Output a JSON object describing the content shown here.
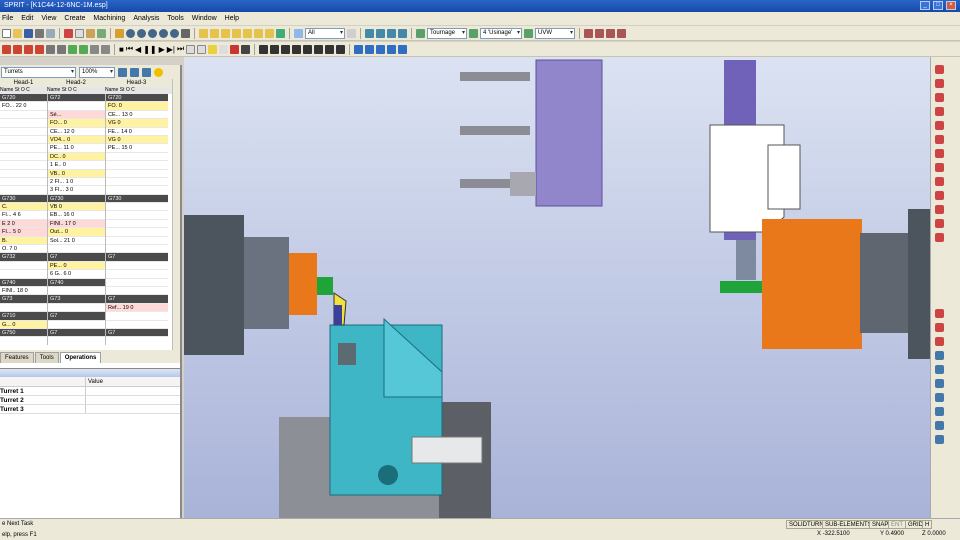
{
  "app": {
    "title": "SPRIT - [K1C44-12-6NC-1M.esp]"
  },
  "menu": [
    "File",
    "Edit",
    "View",
    "Create",
    "Machining",
    "Analysis",
    "Tools",
    "Window",
    "Help"
  ],
  "toolbar": {
    "filter_combo": "All",
    "operation_combo": "Tournage",
    "usinage_combo": "4 'Usinage'",
    "axis_combo": "UVW"
  },
  "left_panel": {
    "machine_combo": "Turrets",
    "zoom_combo": "100%",
    "heads": [
      "Head-1",
      "Head-2",
      "Head-3"
    ],
    "col_headers": {
      "h1": [
        "Name",
        "St",
        "O",
        "C"
      ],
      "h2": [
        "Name",
        "St",
        "O",
        "C"
      ],
      "h3": [
        "Name",
        "St",
        "O",
        "C"
      ]
    },
    "head1_rows": [
      {
        "t": "G720",
        "k": "g"
      },
      {
        "t": "FO...     22  0",
        "k": ""
      },
      {
        "t": "",
        "k": ""
      },
      {
        "t": "",
        "k": ""
      },
      {
        "t": "",
        "k": ""
      },
      {
        "t": "",
        "k": ""
      },
      {
        "t": "",
        "k": ""
      },
      {
        "t": "",
        "k": ""
      },
      {
        "t": "",
        "k": ""
      },
      {
        "t": "",
        "k": ""
      },
      {
        "t": "",
        "k": ""
      },
      {
        "t": "",
        "k": ""
      },
      {
        "t": "G730",
        "k": "g"
      },
      {
        "t": "C.",
        "k": "y"
      },
      {
        "t": "FI...    4  6",
        "k": ""
      },
      {
        "t": "E         2  0",
        "k": "r"
      },
      {
        "t": "FI...    5  0",
        "k": "r"
      },
      {
        "t": "B.",
        "k": "y"
      },
      {
        "t": "O.        7  0",
        "k": ""
      },
      {
        "t": "G732",
        "k": "g"
      },
      {
        "t": "",
        "k": ""
      },
      {
        "t": "",
        "k": ""
      },
      {
        "t": "G740",
        "k": "g"
      },
      {
        "t": "FINI..   18  0",
        "k": ""
      },
      {
        "t": "G73",
        "k": "g"
      },
      {
        "t": "",
        "k": ""
      },
      {
        "t": "G710",
        "k": "g"
      },
      {
        "t": "G...          0",
        "k": "y"
      },
      {
        "t": "G750",
        "k": "g"
      },
      {
        "t": "",
        "k": ""
      }
    ],
    "head2_rows": [
      {
        "t": "G72",
        "k": "g"
      },
      {
        "t": "",
        "k": ""
      },
      {
        "t": "Sé...",
        "k": "r"
      },
      {
        "t": "FO...          0",
        "k": "y"
      },
      {
        "t": "CE...    12  0",
        "k": ""
      },
      {
        "t": "VO4...        0",
        "k": "y"
      },
      {
        "t": "PE...   11  0",
        "k": ""
      },
      {
        "t": "DC..          0",
        "k": "y"
      },
      {
        "t": "1 E..         0",
        "k": ""
      },
      {
        "t": "VB..          0",
        "k": "y"
      },
      {
        "t": "2 FI...     1  0",
        "k": ""
      },
      {
        "t": "3 FI...     3  0",
        "k": ""
      },
      {
        "t": "G730",
        "k": "g"
      },
      {
        "t": "VB            0",
        "k": "y"
      },
      {
        "t": "EB...   16  0",
        "k": ""
      },
      {
        "t": "FINI..  17  0",
        "k": "r"
      },
      {
        "t": "Out...        0",
        "k": "y"
      },
      {
        "t": "Sol...  21  0",
        "k": ""
      },
      {
        "t": "",
        "k": ""
      },
      {
        "t": "G7",
        "k": "g"
      },
      {
        "t": "PE...          0",
        "k": "y"
      },
      {
        "t": "6 G..      6  0",
        "k": ""
      },
      {
        "t": "G740",
        "k": "g"
      },
      {
        "t": "",
        "k": ""
      },
      {
        "t": "G73",
        "k": "g"
      },
      {
        "t": "",
        "k": ""
      },
      {
        "t": "G7",
        "k": "g"
      },
      {
        "t": "",
        "k": ""
      },
      {
        "t": "G7",
        "k": "g"
      },
      {
        "t": "",
        "k": ""
      }
    ],
    "head3_rows": [
      {
        "t": "G720",
        "k": "g"
      },
      {
        "t": "FO.           0",
        "k": "y"
      },
      {
        "t": "CE...     13  0",
        "k": ""
      },
      {
        "t": "VG            0",
        "k": "y"
      },
      {
        "t": "FE...    14  0",
        "k": ""
      },
      {
        "t": "VG            0",
        "k": "y"
      },
      {
        "t": "PE...    15  0",
        "k": ""
      },
      {
        "t": "",
        "k": ""
      },
      {
        "t": "",
        "k": ""
      },
      {
        "t": "",
        "k": ""
      },
      {
        "t": "",
        "k": ""
      },
      {
        "t": "",
        "k": ""
      },
      {
        "t": "G730",
        "k": "g"
      },
      {
        "t": "",
        "k": ""
      },
      {
        "t": "",
        "k": ""
      },
      {
        "t": "",
        "k": ""
      },
      {
        "t": "",
        "k": ""
      },
      {
        "t": "",
        "k": ""
      },
      {
        "t": "",
        "k": ""
      },
      {
        "t": "G7",
        "k": "g"
      },
      {
        "t": "",
        "k": ""
      },
      {
        "t": "",
        "k": ""
      },
      {
        "t": "",
        "k": ""
      },
      {
        "t": "",
        "k": ""
      },
      {
        "t": "G7",
        "k": "g"
      },
      {
        "t": "Ref...   19  0",
        "k": "r"
      },
      {
        "t": "",
        "k": ""
      },
      {
        "t": "",
        "k": ""
      },
      {
        "t": "G7",
        "k": "g"
      },
      {
        "t": "",
        "k": ""
      }
    ],
    "tabs": [
      "Features",
      "Tools",
      "Operations"
    ],
    "props_columns": [
      "",
      "Value"
    ],
    "props_rows": [
      "Turret 1",
      "Turret 2",
      "Turret 3"
    ]
  },
  "status": {
    "line1": "e Next Task",
    "line2": "elp, press F1",
    "modes": [
      "SOLIDTURN",
      "SUB-ELEMENTS",
      "SNAP",
      "ENT",
      "GRID",
      "H"
    ],
    "coords": [
      "X -322.5100",
      "Y 0.4900",
      "Z 0.0000"
    ]
  },
  "colors": {
    "spindle_orange": "#e8781a",
    "chuck_gray": "#5f6670",
    "turret_cyan": "#3fb6c6",
    "tool_purple": "#9185cc",
    "viewport_bg": "#b8c1e0"
  }
}
